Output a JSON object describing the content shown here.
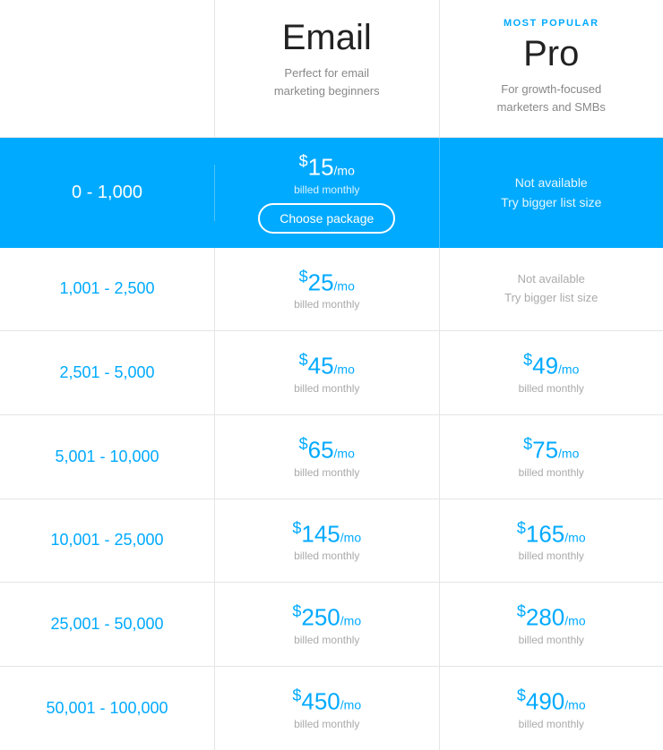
{
  "header": {
    "col_range_label": "",
    "plans": [
      {
        "id": "email",
        "most_popular": false,
        "most_popular_label": "",
        "name": "Email",
        "description": "Perfect for email\nmarketing beginners"
      },
      {
        "id": "pro",
        "most_popular": true,
        "most_popular_label": "MOST POPULAR",
        "name": "Pro",
        "description": "For growth-focused\nmarketers and SMBs"
      }
    ]
  },
  "rows": [
    {
      "range": "0 - 1,000",
      "highlighted": true,
      "plans": [
        {
          "price": "$15",
          "mo": "/mo",
          "billed": "billed monthly",
          "cta": "Choose package",
          "available": true
        },
        {
          "available": false,
          "not_available_line1": "Not available",
          "not_available_line2": "Try bigger list size"
        }
      ]
    },
    {
      "range": "1,001 - 2,500",
      "highlighted": false,
      "plans": [
        {
          "price": "$25",
          "mo": "/mo",
          "billed": "billed monthly",
          "available": true
        },
        {
          "available": false,
          "not_available_line1": "Not available",
          "not_available_line2": "Try bigger list size"
        }
      ]
    },
    {
      "range": "2,501 - 5,000",
      "highlighted": false,
      "plans": [
        {
          "price": "$45",
          "mo": "/mo",
          "billed": "billed monthly",
          "available": true
        },
        {
          "price": "$49",
          "mo": "/mo",
          "billed": "billed monthly",
          "available": true
        }
      ]
    },
    {
      "range": "5,001 - 10,000",
      "highlighted": false,
      "plans": [
        {
          "price": "$65",
          "mo": "/mo",
          "billed": "billed monthly",
          "available": true
        },
        {
          "price": "$75",
          "mo": "/mo",
          "billed": "billed monthly",
          "available": true
        }
      ]
    },
    {
      "range": "10,001 - 25,000",
      "highlighted": false,
      "plans": [
        {
          "price": "$145",
          "mo": "/mo",
          "billed": "billed monthly",
          "available": true
        },
        {
          "price": "$165",
          "mo": "/mo",
          "billed": "billed monthly",
          "available": true
        }
      ]
    },
    {
      "range": "25,001 - 50,000",
      "highlighted": false,
      "plans": [
        {
          "price": "$250",
          "mo": "/mo",
          "billed": "billed monthly",
          "available": true
        },
        {
          "price": "$280",
          "mo": "/mo",
          "billed": "billed monthly",
          "available": true
        }
      ]
    },
    {
      "range": "50,001 - 100,000",
      "highlighted": false,
      "plans": [
        {
          "price": "$450",
          "mo": "/mo",
          "billed": "billed monthly",
          "available": true
        },
        {
          "price": "$490",
          "mo": "/mo",
          "billed": "billed monthly",
          "available": true
        }
      ]
    }
  ]
}
